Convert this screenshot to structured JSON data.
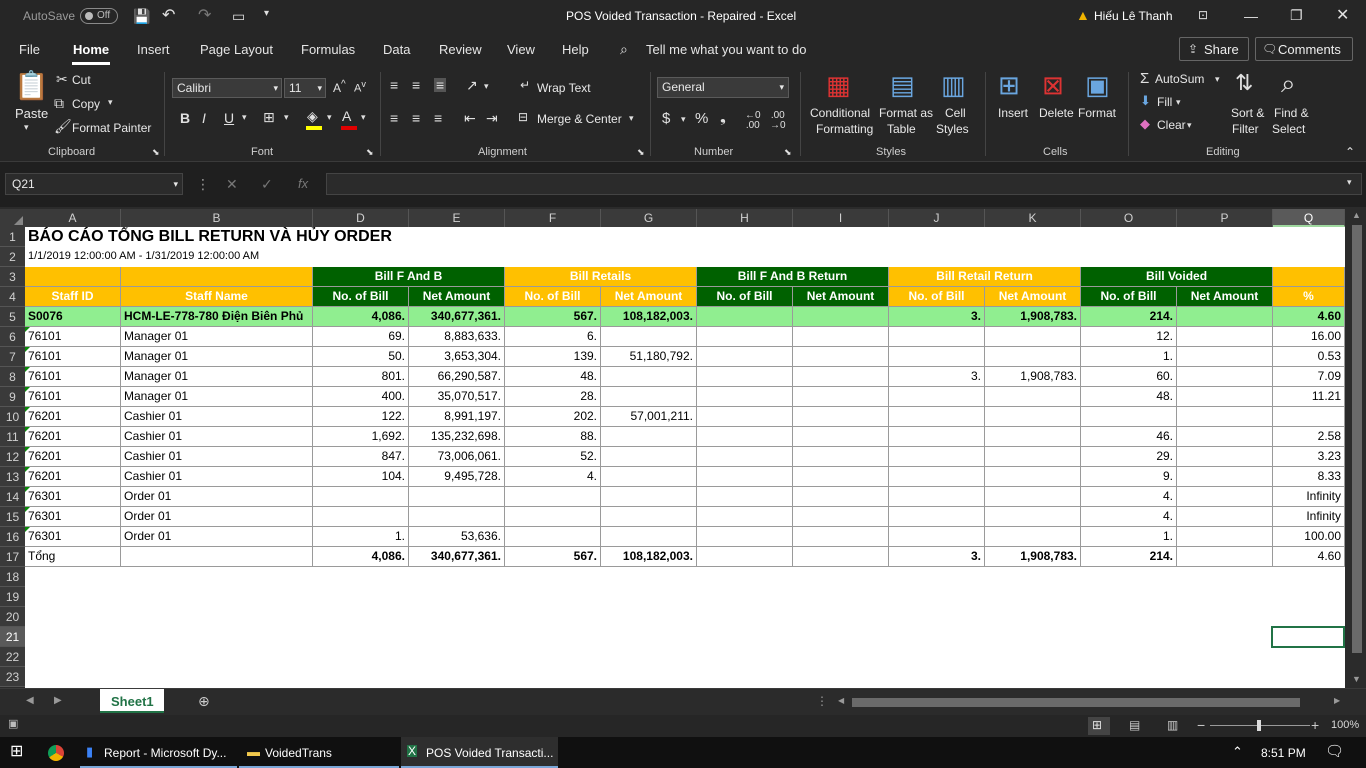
{
  "titlebar": {
    "autosave_label": "AutoSave",
    "autosave_state": "Off",
    "title": "POS Voided Transaction  -  Repaired  -  Excel",
    "user": "Hiếu Lê Thanh"
  },
  "tabs": [
    "File",
    "Home",
    "Insert",
    "Page Layout",
    "Formulas",
    "Data",
    "Review",
    "View",
    "Help"
  ],
  "active_tab": "Home",
  "tell_me": "Tell me what you want to do",
  "share_label": "Share",
  "comments_label": "Comments",
  "ribbon": {
    "clipboard": {
      "paste": "Paste",
      "cut": "Cut",
      "copy": "Copy",
      "format_painter": "Format Painter",
      "group": "Clipboard"
    },
    "font": {
      "name": "Calibri",
      "size": "11",
      "group": "Font"
    },
    "alignment": {
      "wrap": "Wrap Text",
      "merge": "Merge & Center",
      "group": "Alignment"
    },
    "number": {
      "format": "General",
      "group": "Number"
    },
    "styles": {
      "conditional": "Conditional",
      "conditional2": "Formatting",
      "format_as": "Format as",
      "format_as2": "Table",
      "cell": "Cell",
      "cell2": "Styles",
      "group": "Styles"
    },
    "cells": {
      "insert": "Insert",
      "delete": "Delete",
      "format": "Format",
      "group": "Cells"
    },
    "editing": {
      "autosum": "AutoSum",
      "fill": "Fill",
      "clear": "Clear",
      "sort": "Sort &",
      "sort2": "Filter",
      "find": "Find &",
      "find2": "Select",
      "group": "Editing"
    }
  },
  "namebox": "Q21",
  "columns": [
    "A",
    "B",
    "D",
    "E",
    "F",
    "G",
    "H",
    "I",
    "J",
    "K",
    "O",
    "P",
    "Q"
  ],
  "rows": [
    "1",
    "2",
    "3",
    "4",
    "5",
    "6",
    "7",
    "8",
    "9",
    "10",
    "11",
    "12",
    "13",
    "14",
    "15",
    "16",
    "17",
    "18",
    "19",
    "20",
    "21",
    "22",
    "23"
  ],
  "report": {
    "title": "BÁO CÁO TỔNG BILL RETURN VÀ HỦY ORDER",
    "subtitle": "1/1/2019 12:00:00 AM - 1/31/2019 12:00:00 AM",
    "groups": [
      "Bill F And B",
      "Bill Retails",
      "Bill F And B Return",
      "Bill Retail Return",
      "Bill Voided"
    ],
    "headers": [
      "Staff ID",
      "Staff Name",
      "No. of Bill",
      "Net Amount",
      "No. of Bill",
      "Net Amount",
      "No. of Bill",
      "Net Amount",
      "No. of Bill",
      "Net Amount",
      "No. of Bill",
      "Net Amount",
      "%"
    ],
    "rows": [
      [
        "S0076",
        "HCM-LE-778-780 Điện Biên Phủ",
        "4,086.",
        "340,677,361.",
        "567.",
        "108,182,003.",
        "",
        "",
        "3.",
        "1,908,783.",
        "214.",
        "",
        "4.60"
      ],
      [
        "76101",
        "Manager 01",
        "69.",
        "8,883,633.",
        "6.",
        "",
        "",
        "",
        "",
        "",
        "12.",
        "",
        "16.00"
      ],
      [
        "76101",
        "Manager 01",
        "50.",
        "3,653,304.",
        "139.",
        "51,180,792.",
        "",
        "",
        "",
        "",
        "1.",
        "",
        "0.53"
      ],
      [
        "76101",
        "Manager 01",
        "801.",
        "66,290,587.",
        "48.",
        "",
        "",
        "",
        "3.",
        "1,908,783.",
        "60.",
        "",
        "7.09"
      ],
      [
        "76101",
        "Manager 01",
        "400.",
        "35,070,517.",
        "28.",
        "",
        "",
        "",
        "",
        "",
        "48.",
        "",
        "11.21"
      ],
      [
        "76201",
        "Cashier 01",
        "122.",
        "8,991,197.",
        "202.",
        "57,001,211.",
        "",
        "",
        "",
        "",
        "",
        "",
        ""
      ],
      [
        "76201",
        "Cashier 01",
        "1,692.",
        "135,232,698.",
        "88.",
        "",
        "",
        "",
        "",
        "",
        "46.",
        "",
        "2.58"
      ],
      [
        "76201",
        "Cashier 01",
        "847.",
        "73,006,061.",
        "52.",
        "",
        "",
        "",
        "",
        "",
        "29.",
        "",
        "3.23"
      ],
      [
        "76201",
        "Cashier 01",
        "104.",
        "9,495,728.",
        "4.",
        "",
        "",
        "",
        "",
        "",
        "9.",
        "",
        "8.33"
      ],
      [
        "76301",
        "Order 01",
        "",
        "",
        "",
        "",
        "",
        "",
        "",
        "",
        "4.",
        "",
        "Infinity"
      ],
      [
        "76301",
        "Order 01",
        "",
        "",
        "",
        "",
        "",
        "",
        "",
        "",
        "4.",
        "",
        "Infinity"
      ],
      [
        "76301",
        "Order 01",
        "1.",
        "53,636.",
        "",
        "",
        "",
        "",
        "",
        "",
        "1.",
        "",
        "100.00"
      ],
      [
        "Tổng",
        "",
        "4,086.",
        "340,677,361.",
        "567.",
        "108,182,003.",
        "",
        "",
        "3.",
        "1,908,783.",
        "214.",
        "",
        "4.60"
      ]
    ]
  },
  "sheet_tab": "Sheet1",
  "zoom": "100%",
  "taskbar": {
    "items": [
      "Report - Microsoft Dy...",
      "VoidedTrans",
      "POS Voided Transacti..."
    ],
    "time": "8:51 PM"
  },
  "colors": {
    "header_green": "#006100",
    "header_yellow": "#ffc000",
    "highlight_row": "#90ee90",
    "excel_green": "#217346"
  }
}
